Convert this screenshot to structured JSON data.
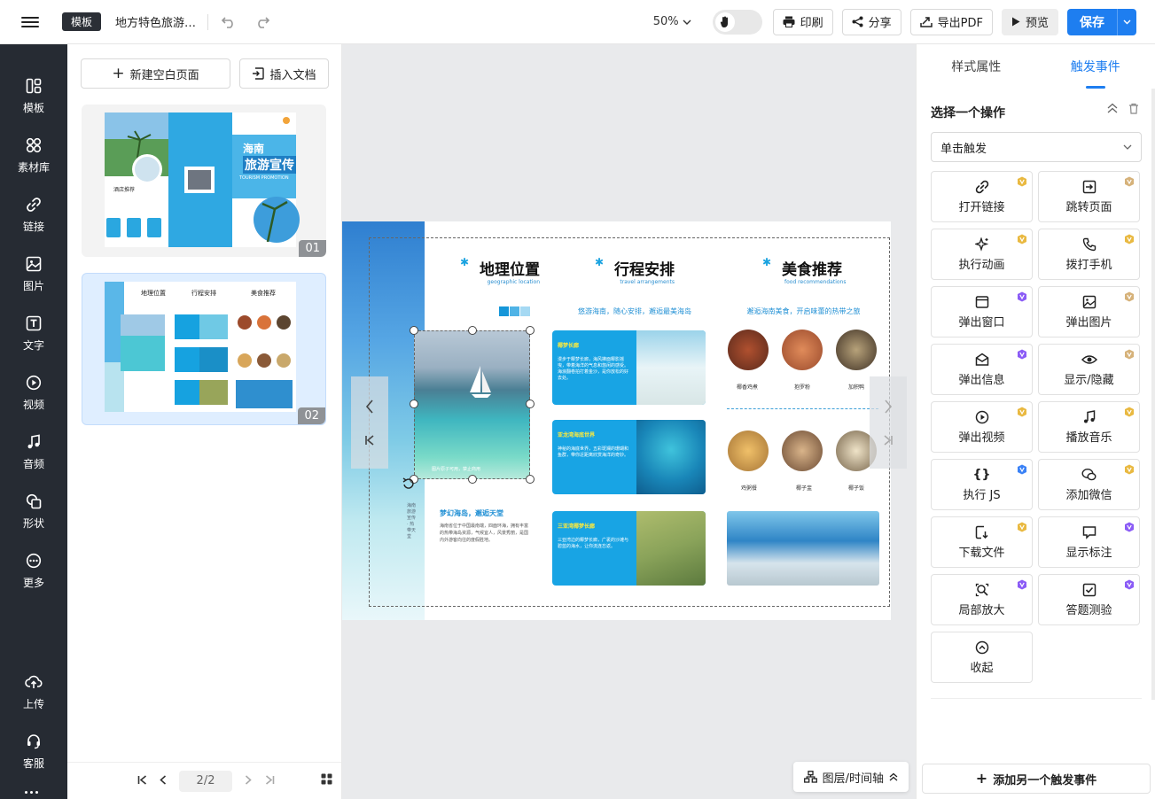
{
  "topbar": {
    "template_badge": "模板",
    "doc_title": "地方特色旅游…",
    "zoom": "50%",
    "print_label": "印刷",
    "share_label": "分享",
    "export_pdf_label": "导出PDF",
    "preview_label": "预览",
    "save_label": "保存"
  },
  "rail": {
    "items": [
      {
        "label": "模板",
        "icon": "template-icon"
      },
      {
        "label": "素材库",
        "icon": "material-icon"
      },
      {
        "label": "链接",
        "icon": "link-icon"
      },
      {
        "label": "图片",
        "icon": "image-icon"
      },
      {
        "label": "文字",
        "icon": "text-icon"
      },
      {
        "label": "视频",
        "icon": "video-icon"
      },
      {
        "label": "音频",
        "icon": "music-icon"
      },
      {
        "label": "形状",
        "icon": "shape-icon"
      },
      {
        "label": "更多",
        "icon": "more-icon"
      },
      {
        "label": "上传",
        "icon": "upload-icon"
      },
      {
        "label": "客服",
        "icon": "headset-icon"
      }
    ]
  },
  "pages_panel": {
    "new_page_label": "新建空白页面",
    "insert_doc_label": "插入文档",
    "thumbnails": [
      {
        "number": "01",
        "title_line1": "海南",
        "title_line2": "旅游宣传",
        "subtitle": "TOURISM PROMOTION",
        "side_text": "酒店推荐"
      },
      {
        "number": "02",
        "headings": [
          "地理位置",
          "行程安排",
          "美食推荐"
        ]
      }
    ],
    "pager": {
      "current": "2",
      "total": "/2"
    }
  },
  "canvas": {
    "page": {
      "headings": [
        {
          "title": "地理位置",
          "sub": "geographic location"
        },
        {
          "title": "行程安排",
          "sub": "travel arrangements"
        },
        {
          "title": "美食推荐",
          "sub": "food recommendations"
        }
      ],
      "itinerary_tagline": "悠游海南，随心安排，邂逅最美海岛",
      "food_tagline": "邂逅海南美食，开启味蕾的热带之旅",
      "itinerary_cards": [
        {
          "title": "椰梦长廊",
          "text": "漫步于椰梦长廊，海风拂面椰影摇曳，带着海洋的气息和悠闲的感受。海浪翻卷拍打着金沙，是你放松的好去处。"
        },
        {
          "title": "亚龙湾海底世界",
          "text": "神秘的海底世界，五彩斑斓的珊瑚和鱼群，带你近距离欣赏海洋的奇妙。"
        },
        {
          "title": "三亚湾椰梦长廊",
          "text": "三亚湾边的椰梦长廊，广袤的沙滩与碧蓝的海水，让你流连忘返。"
        }
      ],
      "photo_caption": "图片原子可用，禁止商用",
      "foods_row1": [
        "椰香鸡煮",
        "抱罗粉",
        "加积鸭"
      ],
      "foods_row2": [
        "鸡粥餐",
        "椰子盅",
        "椰子饭"
      ],
      "geo_heading": "梦幻海岛，邂逅天堂",
      "geo_text": "海南省位于中国最南端，四面环海，拥有丰富的热带海岛资源，气候宜人，风景秀丽，是国内外游客向往的度假胜地。",
      "vertical_text": "海南旅游宣传 · 热带天堂"
    },
    "layers_label": "图层/时间轴"
  },
  "right_panel": {
    "tabs": [
      "样式属性",
      "触发事件"
    ],
    "active_tab": 1,
    "section_title": "选择一个操作",
    "trigger_select": "单击触发",
    "actions": [
      {
        "label": "打开链接",
        "icon": "link-icon",
        "badge": "gold"
      },
      {
        "label": "跳转页面",
        "icon": "jump-page-icon",
        "badge": "gold"
      },
      {
        "label": "执行动画",
        "icon": "sparkle-icon",
        "badge": "gold"
      },
      {
        "label": "拨打手机",
        "icon": "phone-icon",
        "badge": "gold"
      },
      {
        "label": "弹出窗口",
        "icon": "window-icon",
        "badge": "purple"
      },
      {
        "label": "弹出图片",
        "icon": "image-icon",
        "badge": "gold"
      },
      {
        "label": "弹出信息",
        "icon": "mail-icon",
        "badge": "purple"
      },
      {
        "label": "显示/隐藏",
        "icon": "eye-icon",
        "badge": "gold"
      },
      {
        "label": "弹出视频",
        "icon": "play-icon",
        "badge": "gold"
      },
      {
        "label": "播放音乐",
        "icon": "music-icon",
        "badge": "gold"
      },
      {
        "label": "执行 JS",
        "icon": "code-icon",
        "badge": "blue"
      },
      {
        "label": "添加微信",
        "icon": "wechat-icon",
        "badge": "gold"
      },
      {
        "label": "下载文件",
        "icon": "download-icon",
        "badge": "gold"
      },
      {
        "label": "显示标注",
        "icon": "comment-icon",
        "badge": "purple"
      },
      {
        "label": "局部放大",
        "icon": "zoom-icon",
        "badge": "purple"
      },
      {
        "label": "答题测验",
        "icon": "quiz-icon",
        "badge": "purple"
      },
      {
        "label": "收起",
        "icon": "collapse-icon",
        "badge": ""
      }
    ],
    "add_event_label": "添加另一个触发事件"
  },
  "colors": {
    "accent": "#1e7ef0",
    "rail_bg": "#262b33",
    "badge_gold": "#e9b941",
    "badge_purple": "#8b5cf6",
    "badge_blue": "#3b82f6",
    "brochure_blue": "#17a8e3"
  }
}
